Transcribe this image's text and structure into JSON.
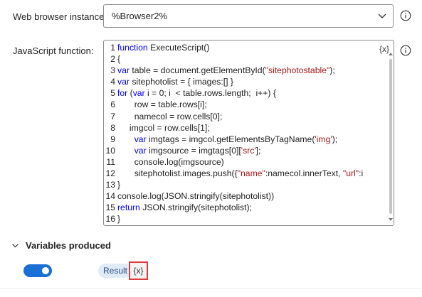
{
  "browser": {
    "label": "Web browser instance:",
    "value": "%Browser2%"
  },
  "js": {
    "label": "JavaScript function:",
    "var_button": "{x}",
    "lines": [
      {
        "n": "1",
        "parts": [
          [
            "kw",
            "function"
          ],
          [
            "txt",
            " ExecuteScript()"
          ]
        ]
      },
      {
        "n": "2",
        "parts": [
          [
            "txt",
            "{"
          ]
        ]
      },
      {
        "n": "3",
        "parts": [
          [
            "kw",
            "var"
          ],
          [
            "txt",
            " table = document.getElementById("
          ],
          [
            "str",
            "\"sitephotostable\""
          ],
          [
            "txt",
            ");"
          ]
        ]
      },
      {
        "n": "4",
        "parts": [
          [
            "kw",
            "var"
          ],
          [
            "txt",
            " sitephotolist = { images:[] }"
          ]
        ]
      },
      {
        "n": "5",
        "parts": [
          [
            "kw",
            "for"
          ],
          [
            "txt",
            " ("
          ],
          [
            "kw",
            "var"
          ],
          [
            "txt",
            " i = 0; i  < table.rows.length;  i++) {"
          ]
        ]
      },
      {
        "n": "6",
        "parts": [
          [
            "txt",
            "       row = table.rows[i];"
          ]
        ]
      },
      {
        "n": "7",
        "parts": [
          [
            "txt",
            "       namecol = row.cells[0];"
          ]
        ]
      },
      {
        "n": "8",
        "parts": [
          [
            "txt",
            "     imgcol = row.cells[1];"
          ]
        ]
      },
      {
        "n": "9",
        "parts": [
          [
            "txt",
            "       "
          ],
          [
            "kw",
            "var"
          ],
          [
            "txt",
            " imgtags = imgcol.getElementsByTagName("
          ],
          [
            "str",
            "'img'"
          ],
          [
            "txt",
            ");"
          ]
        ]
      },
      {
        "n": "10",
        "parts": [
          [
            "txt",
            "       "
          ],
          [
            "kw",
            "var"
          ],
          [
            "txt",
            " imgsource = imgtags[0]["
          ],
          [
            "str",
            "'src'"
          ],
          [
            "txt",
            "];"
          ]
        ]
      },
      {
        "n": "11",
        "parts": [
          [
            "txt",
            "       console.log(imgsource)"
          ]
        ]
      },
      {
        "n": "12",
        "parts": [
          [
            "txt",
            "       sitephotolist.images.push({"
          ],
          [
            "str",
            "\"name\""
          ],
          [
            "txt",
            ":namecol.innerText, "
          ],
          [
            "str",
            "\"url\""
          ],
          [
            "txt",
            ":i"
          ]
        ]
      },
      {
        "n": "13",
        "parts": [
          [
            "txt",
            "}"
          ]
        ]
      },
      {
        "n": "14",
        "parts": [
          [
            "txt",
            "console.log(JSON.stringify(sitephotolist))"
          ]
        ]
      },
      {
        "n": "15",
        "parts": [
          [
            "kw",
            "return"
          ],
          [
            "txt",
            " JSON.stringify(sitephotolist);"
          ]
        ]
      },
      {
        "n": "16",
        "parts": [
          [
            "txt",
            "}"
          ]
        ]
      }
    ]
  },
  "variables": {
    "section_title": "Variables produced",
    "toggle_on": true,
    "result_label": "Result",
    "result_var_button": "{x}"
  },
  "colors": {
    "accent": "#1a6fd6",
    "keyword": "#0000ff",
    "string": "#a31515",
    "highlight": "#e03a3a"
  },
  "icons": [
    "chevron-down-icon",
    "info-icon",
    "chevron-down-icon"
  ]
}
